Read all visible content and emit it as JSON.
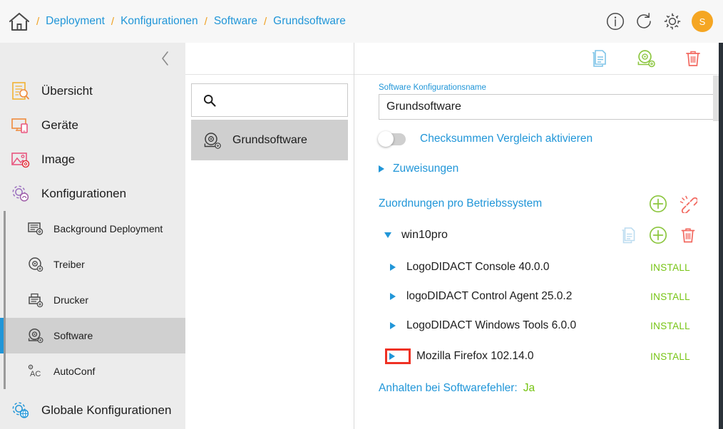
{
  "topbar": {
    "home_icon": "home-icon",
    "separator": "/",
    "breadcrumb": [
      {
        "label": "Deployment"
      },
      {
        "label": "Konfigurationen"
      },
      {
        "label": "Software"
      },
      {
        "label": "Grundsoftware"
      }
    ],
    "actions": [
      {
        "name": "info-icon",
        "label": "i"
      },
      {
        "name": "refresh-icon",
        "label": ""
      },
      {
        "name": "gear-icon",
        "label": ""
      }
    ],
    "avatar_initial": "S",
    "avatar_color": "#f5a623",
    "link_color": "#2196d8",
    "separator_color": "#f0a020"
  },
  "sidebar": {
    "collapse_icon": "chevron-left-icon",
    "items": [
      {
        "label": "Übersicht",
        "icon": "overview-icon"
      },
      {
        "label": "Geräte",
        "icon": "devices-icon"
      },
      {
        "label": "Image",
        "icon": "image-icon"
      },
      {
        "label": "Konfigurationen",
        "icon": "configurations-gear-icon"
      }
    ],
    "subitems": [
      {
        "label": "Background Deployment",
        "icon": "background-deployment-icon",
        "active": false
      },
      {
        "label": "Treiber",
        "icon": "driver-disk-icon",
        "active": false
      },
      {
        "label": "Drucker",
        "icon": "printer-icon",
        "active": false
      },
      {
        "label": "Software",
        "icon": "software-disk-icon",
        "active": true
      },
      {
        "label": "AutoConf",
        "icon": "autoconf-icon",
        "active": false
      }
    ],
    "footer_item": {
      "label": "Globale Konfigurationen",
      "icon": "global-configurations-icon"
    },
    "active_accent": "#2196d8",
    "background": "#ececec"
  },
  "midpanel": {
    "collapse_icon": "chevron-left-icon",
    "search": {
      "icon": "search-icon",
      "placeholder": "",
      "value": ""
    },
    "items": [
      {
        "label": "Grundsoftware",
        "icon": "software-disk-icon",
        "selected": true
      }
    ]
  },
  "main": {
    "back_icon": "chevron-left-icon",
    "toolbar": [
      {
        "name": "duplicate-icon",
        "color": "#7fc4e8"
      },
      {
        "name": "software-disk-icon",
        "color": "#8cc63f"
      },
      {
        "name": "delete-trash-icon",
        "color": "#f2685f"
      }
    ],
    "name_field": {
      "label": "Software Konfigurationsname",
      "value": "Grundsoftware"
    },
    "checksum_toggle": {
      "label": "Checksummen Vergleich aktivieren",
      "enabled": false
    },
    "assignments": {
      "label": "Zuweisungen",
      "expanded": false
    },
    "os_section": {
      "title": "Zuordnungen pro Betriebssystem",
      "actions": [
        {
          "name": "add-plus-icon",
          "color": "#8cc63f"
        },
        {
          "name": "broken-link-icon",
          "color": "#f2685f"
        }
      ]
    },
    "os_groups": [
      {
        "name": "win10pro",
        "expanded": true,
        "actions": [
          {
            "name": "duplicate-icon",
            "color": "#bcdcf0"
          },
          {
            "name": "add-plus-icon",
            "color": "#8cc63f"
          },
          {
            "name": "delete-trash-icon",
            "color": "#f2685f"
          }
        ],
        "software": [
          {
            "name": "LogoDIDACT Console 40.0.0",
            "state": "INSTALL",
            "expanded": false,
            "highlighted": false
          },
          {
            "name": "logoDIDACT Control Agent 25.0.2",
            "state": "INSTALL",
            "expanded": false,
            "highlighted": false
          },
          {
            "name": "LogoDIDACT Windows Tools 6.0.0",
            "state": "INSTALL",
            "expanded": false,
            "highlighted": false
          },
          {
            "name": "Mozilla Firefox 102.14.0",
            "state": "INSTALL",
            "expanded": false,
            "highlighted": true
          }
        ]
      }
    ],
    "footer": {
      "label": "Anhalten bei Softwarefehler:",
      "value": "Ja"
    },
    "colors": {
      "accent_blue": "#2196d8",
      "state_green": "#76c413",
      "highlight_red": "#ef3124"
    }
  }
}
